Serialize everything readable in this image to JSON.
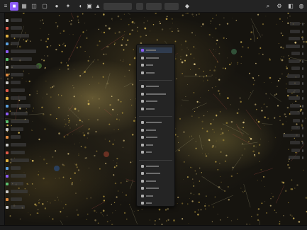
{
  "window": {
    "title": ""
  },
  "toolbar": {
    "left_icons": [
      "app-menu-icon",
      "object-mode-icon",
      "layout-icon",
      "view-icon",
      "snap-icon",
      "light-icon",
      "transform-icon",
      "proportional-icon",
      "render-icon",
      "brush-icon"
    ],
    "mode_select": "",
    "view_select": "",
    "right_icons": [
      "search-icon",
      "settings-icon",
      "overlay-icon",
      "shading-icon"
    ]
  },
  "left_panel": {
    "items": [
      "",
      "",
      "",
      "",
      "",
      "",
      "",
      "",
      "",
      "",
      "",
      "",
      "",
      "",
      "",
      "",
      "",
      "",
      "",
      "",
      "",
      "",
      "",
      "",
      ""
    ]
  },
  "right_panel": {
    "items": [
      "",
      "",
      "",
      "",
      "",
      "",
      "",
      "",
      "",
      "",
      "",
      "",
      "",
      "",
      "",
      "",
      "",
      "",
      ""
    ]
  },
  "context_menu": {
    "sections": [
      {
        "items": [
          {
            "icon": "square-icon",
            "label": "",
            "selected": true
          },
          {
            "icon": "arrow-icon",
            "label": ""
          },
          {
            "icon": "move-icon",
            "label": ""
          },
          {
            "icon": "dots-icon",
            "label": ""
          }
        ]
      },
      {
        "items": [
          {
            "icon": "brush-icon",
            "label": ""
          },
          {
            "icon": "layers-icon",
            "label": ""
          },
          {
            "icon": "scale-icon",
            "label": ""
          },
          {
            "icon": "rotate-icon",
            "label": ""
          }
        ]
      },
      {
        "items": [
          {
            "icon": "circle-icon",
            "label": ""
          },
          {
            "icon": "star-icon",
            "label": ""
          },
          {
            "icon": "fill-icon",
            "label": ""
          },
          {
            "icon": "link-icon",
            "label": ""
          },
          {
            "icon": "text-icon",
            "label": ""
          }
        ]
      },
      {
        "items": [
          {
            "icon": "copy-icon",
            "label": ""
          },
          {
            "icon": "refresh-icon",
            "label": ""
          },
          {
            "icon": "hide-icon",
            "label": ""
          },
          {
            "icon": "merge-icon",
            "label": ""
          },
          {
            "icon": "delete-icon",
            "label": ""
          },
          {
            "icon": "clear-icon",
            "label": ""
          }
        ]
      }
    ]
  },
  "status_bar": {
    "text": ""
  },
  "colors": {
    "accent": "#8b5cf6",
    "menu_bg": "#242424",
    "selection": "#2f3b4e",
    "toolbar_bg": "#232323"
  }
}
